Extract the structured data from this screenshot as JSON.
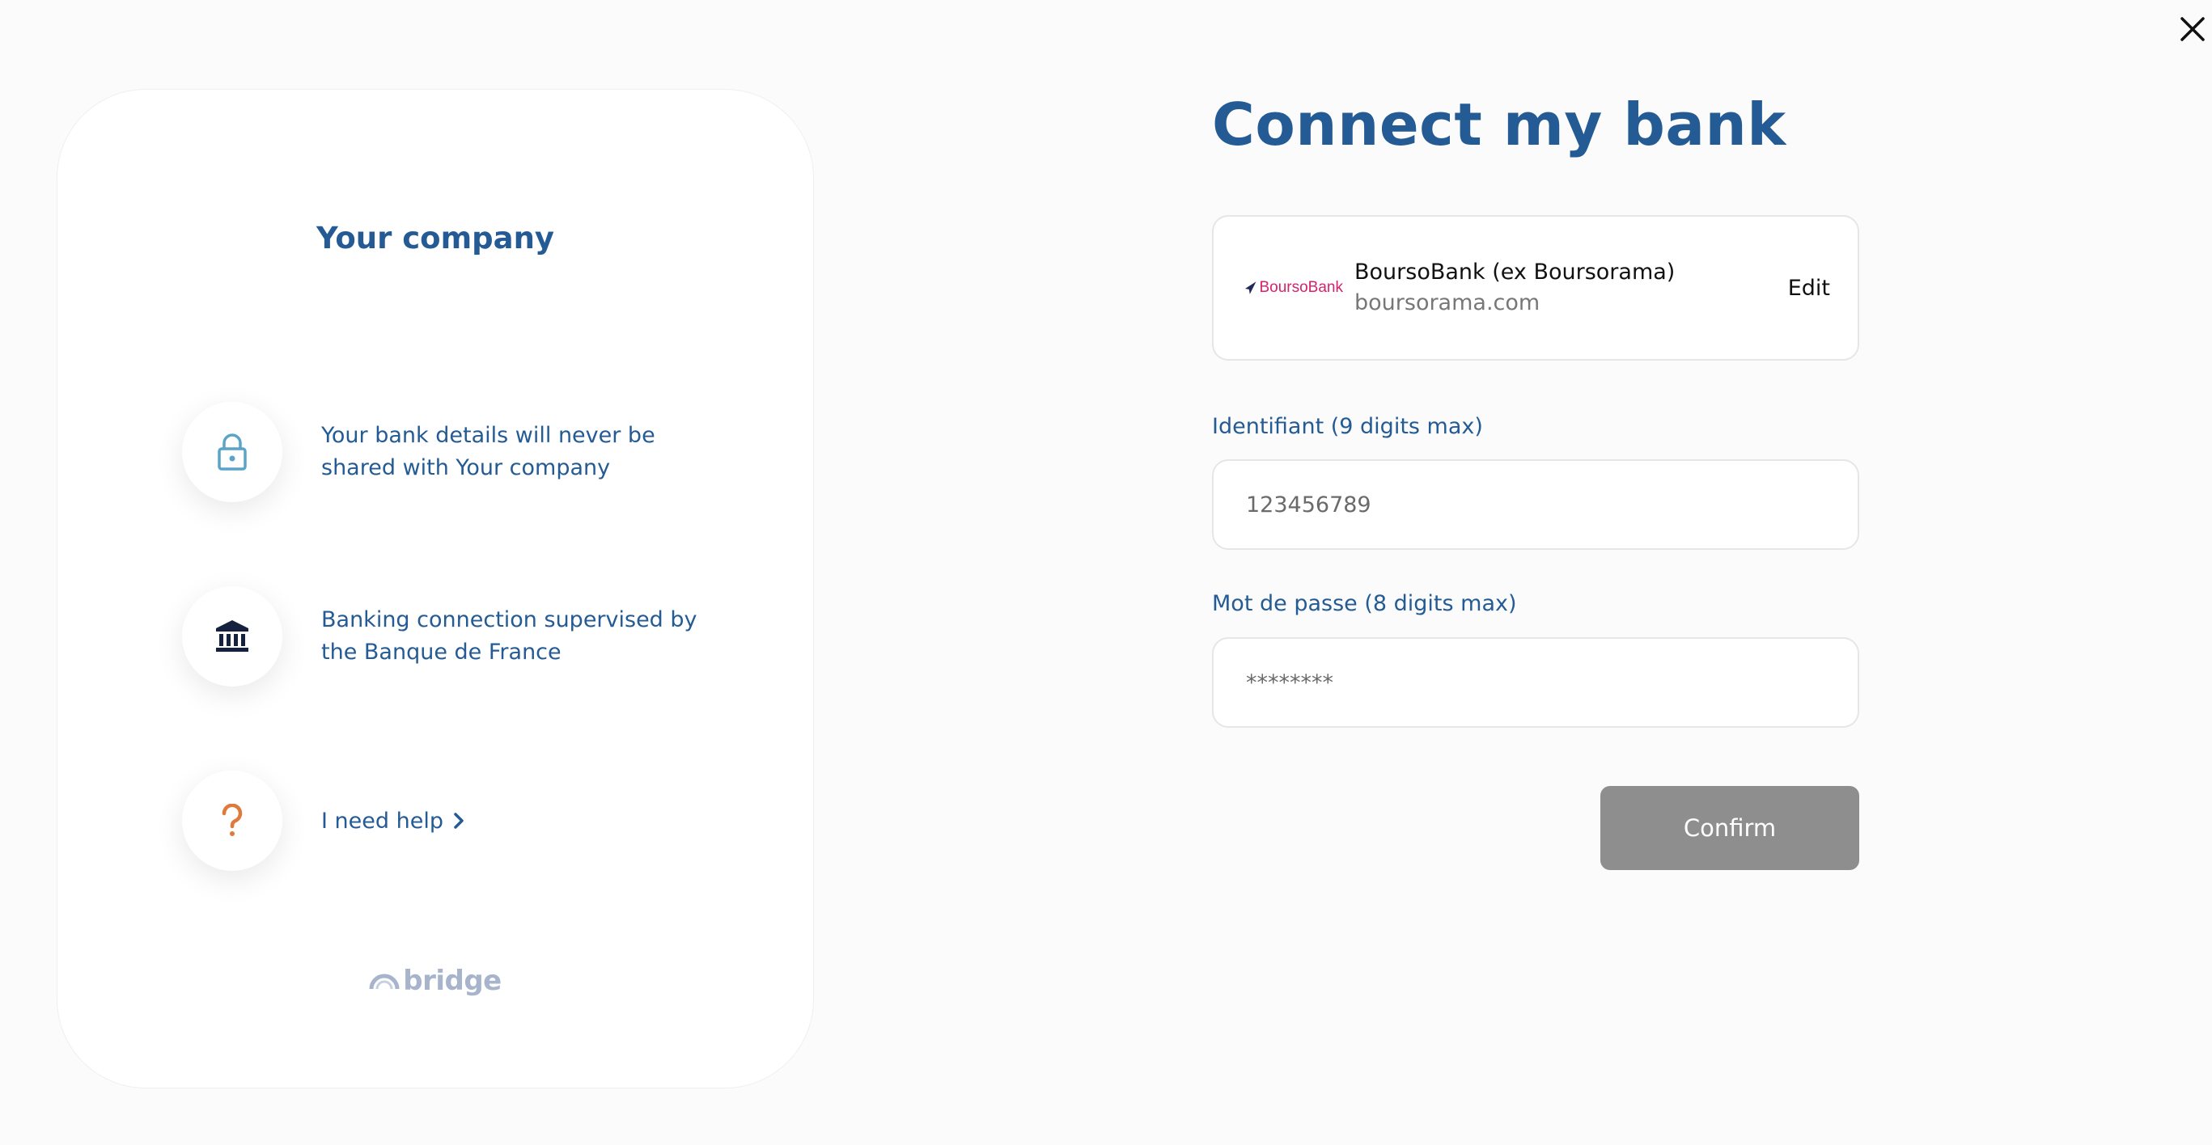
{
  "close": {
    "icon": "close-icon"
  },
  "sidebar": {
    "company_title": "Your company",
    "features": [
      {
        "icon": "lock-icon",
        "text": "Your bank details will never be shared with Your company"
      },
      {
        "icon": "bank-building-icon",
        "text": "Banking connection supervised by the Banque de France"
      }
    ],
    "help": {
      "icon": "question-icon",
      "label": "I need help"
    },
    "brand": "bridge"
  },
  "main": {
    "title": "Connect my bank",
    "bank": {
      "logo_text": "BoursoBank",
      "name": "BoursoBank (ex Boursorama)",
      "domain": "boursorama.com",
      "edit_label": "Edit"
    },
    "fields": [
      {
        "label": "Identifiant (9 digits max)",
        "placeholder": "123456789"
      },
      {
        "label": "Mot de passe (8 digits max)",
        "placeholder": "********"
      }
    ],
    "confirm_label": "Confirm"
  },
  "colors": {
    "accent": "#245b94",
    "help_icon": "#e07a3c",
    "lock_icon": "#5aa4c8",
    "confirm_disabled": "#8e8e8e"
  }
}
